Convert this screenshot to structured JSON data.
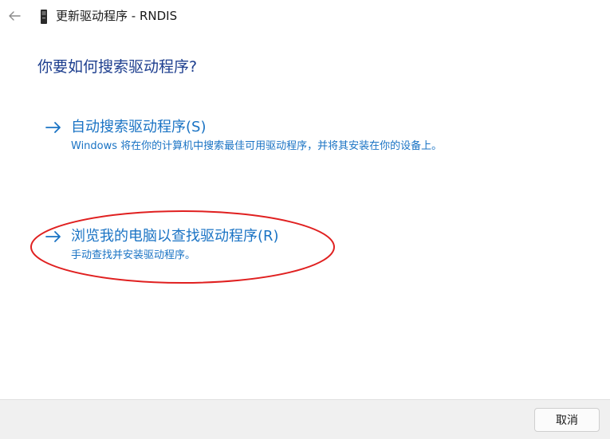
{
  "window": {
    "title": "更新驱动程序 - RNDIS"
  },
  "heading": "你要如何搜索驱动程序?",
  "options": [
    {
      "title": "自动搜索驱动程序(S)",
      "description": "Windows 将在你的计算机中搜索最佳可用驱动程序，并将其安装在你的设备上。",
      "icon": "arrow-right-icon"
    },
    {
      "title": "浏览我的电脑以查找驱动程序(R)",
      "description": "手动查找并安装驱动程序。",
      "icon": "arrow-right-icon",
      "highlighted": true
    }
  ],
  "footer": {
    "cancel_label": "取消"
  },
  "colors": {
    "link": "#1a73c4",
    "heading": "#1e3f8f",
    "annotation": "#e02020",
    "footer_bg": "#f0f0f0"
  },
  "icons": {
    "back": "back-arrow-icon",
    "device": "device-icon"
  }
}
